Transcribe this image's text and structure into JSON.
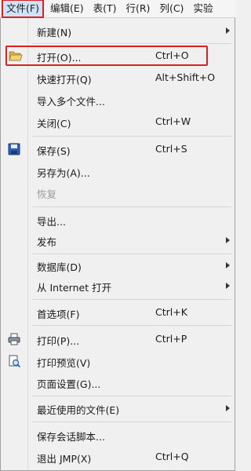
{
  "menubar": {
    "items": [
      "文件(F)",
      "编辑(E)",
      "表(T)",
      "行(R)",
      "列(C)",
      "实验"
    ]
  },
  "file_menu": {
    "new": {
      "label": "新建(N)"
    },
    "open": {
      "label": "打开(O)...",
      "accel": "Ctrl+O",
      "icon": "folder-open-icon"
    },
    "quick_open": {
      "label": "快速打开(Q)",
      "accel": "Alt+Shift+O"
    },
    "import_multiple": {
      "label": "导入多个文件..."
    },
    "close": {
      "label": "关闭(C)",
      "accel": "Ctrl+W"
    },
    "save": {
      "label": "保存(S)",
      "accel": "Ctrl+S",
      "icon": "save-disk-icon"
    },
    "save_as": {
      "label": "另存为(A)..."
    },
    "revert": {
      "label": "恢复",
      "disabled": true
    },
    "export": {
      "label": "导出..."
    },
    "publish": {
      "label": "发布"
    },
    "database": {
      "label": "数据库(D)"
    },
    "from_internet": {
      "label": "从 Internet 打开"
    },
    "preferences": {
      "label": "首选项(F)",
      "accel": "Ctrl+K"
    },
    "print": {
      "label": "打印(P)...",
      "accel": "Ctrl+P",
      "icon": "printer-icon"
    },
    "print_preview": {
      "label": "打印预览(V)",
      "icon": "print-preview-icon"
    },
    "page_setup": {
      "label": "页面设置(G)..."
    },
    "recent_files": {
      "label": "最近使用的文件(E)"
    },
    "save_session_script": {
      "label": "保存会话脚本..."
    },
    "exit": {
      "label": "退出 JMP(X)",
      "accel": "Ctrl+Q"
    }
  },
  "colors": {
    "highlight_border": "#e02020",
    "menu_bg": "#f0f0f0"
  }
}
